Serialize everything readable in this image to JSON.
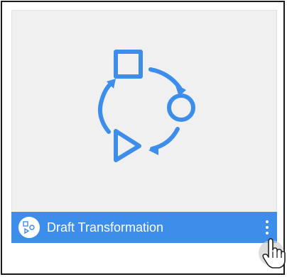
{
  "card": {
    "title": "Draft Transformation",
    "type_icon": "transformation-shapes-icon",
    "menu_icon": "more-vertical-icon",
    "illustration_icon": "transformation-cycle-icon",
    "accent_color": "#3d8eea",
    "thumbnail_bg": "#f0f0f0"
  },
  "pointer": {
    "icon": "hand-pointer-cursor-icon"
  }
}
